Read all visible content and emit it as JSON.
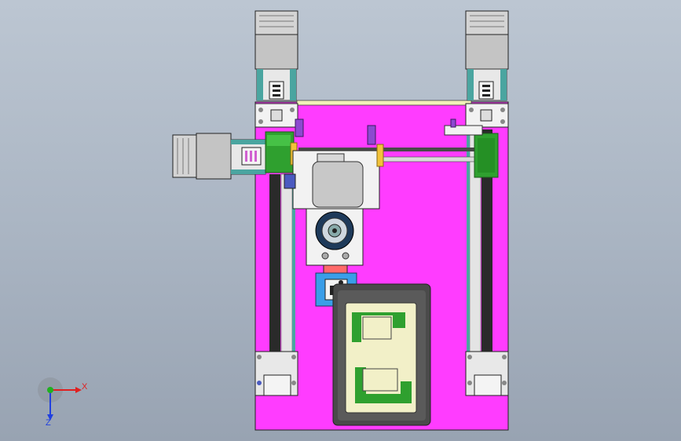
{
  "viewport": {
    "background_top": "#bcc6d2",
    "background_bottom": "#98a3b2"
  },
  "colors": {
    "base_plate": "#ff3cff",
    "motor_body": "#c8c8c8",
    "frame_block": "#f2f2f2",
    "lead_screw": "#2a2a2a",
    "green_block": "#2fa02f",
    "teal_rail": "#4aa5a0",
    "blue_block": "#3a9ee8",
    "yellow_part": "#f2c23a",
    "fixture_dark": "#4a4a4a",
    "fixture_inner": "#f2f0c8"
  },
  "triad": {
    "x_label": "X",
    "z_label": "Z",
    "x_color": "#e02020",
    "y_color": "#20b020",
    "z_color": "#2040e0"
  }
}
